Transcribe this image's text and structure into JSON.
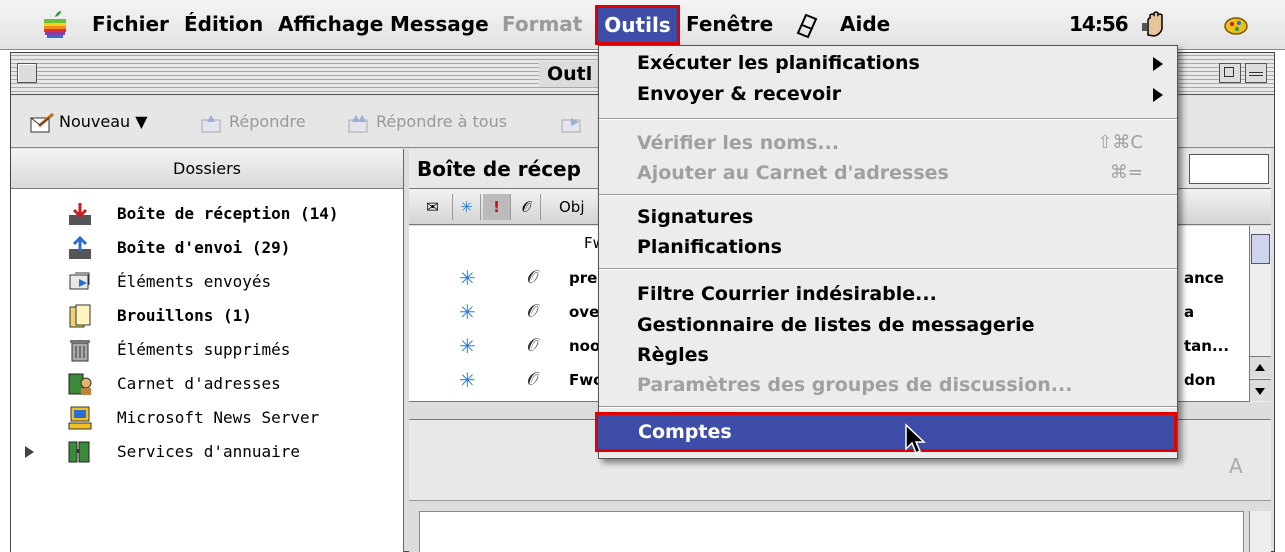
{
  "menubar": {
    "items": [
      "Fichier",
      "Édition",
      "Affichage",
      "Message",
      "Format"
    ],
    "active_menu": "Outils",
    "items_after": [
      "Fenêtre",
      "Aide"
    ],
    "clock": "14:56"
  },
  "window": {
    "title": "Outl"
  },
  "toolbar": {
    "new_label": "Nouveau ▼",
    "reply_label": "Répondre",
    "reply_all_label": "Répondre à tous"
  },
  "sidebar": {
    "header": "Dossiers",
    "folders": [
      {
        "label": "Boîte de réception (14)",
        "bold": true,
        "icon": "inbox-icon"
      },
      {
        "label": "Boîte d'envoi (29)",
        "bold": true,
        "icon": "outbox-icon"
      },
      {
        "label": "Éléments envoyés",
        "bold": false,
        "icon": "sent-icon"
      },
      {
        "label": "Brouillons (1)",
        "bold": true,
        "icon": "drafts-icon"
      },
      {
        "label": "Éléments supprimés",
        "bold": false,
        "icon": "trash-icon"
      },
      {
        "label": "Carnet d'adresses",
        "bold": false,
        "icon": "address-book-icon"
      },
      {
        "label": "Microsoft News Server",
        "bold": false,
        "icon": "news-server-icon"
      },
      {
        "label": "Services d'annuaire",
        "bold": false,
        "icon": "directory-icon"
      }
    ]
  },
  "message_list": {
    "title": "Boîte de récep",
    "subject_column": "Obj",
    "first_row_text": "Fw",
    "rows": [
      {
        "subject": "pre",
        "from": "ance"
      },
      {
        "subject": "ove",
        "from": "a"
      },
      {
        "subject": "noo",
        "from": "tan..."
      },
      {
        "subject": "Fwo",
        "from": "don"
      }
    ]
  },
  "dropdown": {
    "items": [
      {
        "label": "Exécuter les planifications",
        "submenu": true
      },
      {
        "label": "Envoyer & recevoir",
        "submenu": true
      },
      {
        "label": "Vérifier les noms...",
        "shortcut": "⇧⌘C",
        "disabled": true
      },
      {
        "label": "Ajouter au Carnet d'adresses",
        "shortcut": "⌘=",
        "disabled": true
      },
      {
        "label": "Signatures"
      },
      {
        "label": "Planifications"
      },
      {
        "label": "Filtre Courrier indésirable..."
      },
      {
        "label": "Gestionnaire de listes de messagerie"
      },
      {
        "label": "Règles"
      },
      {
        "label": "Paramètres des groupes de discussion...",
        "disabled": true
      },
      {
        "label": "Comptes",
        "highlighted": true
      }
    ]
  },
  "colors": {
    "highlight": "#3e4ea8",
    "annotation_box": "#e00000",
    "dimmed_text": "#a0a0a0"
  }
}
